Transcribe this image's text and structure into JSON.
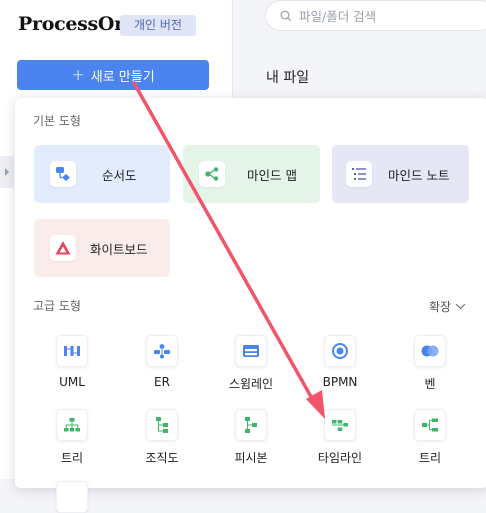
{
  "header": {
    "logo": "ProcessOn",
    "edition_badge": "개인 버전",
    "new_button_label": "새로 만들기",
    "search_placeholder": "파일/폴더 검색",
    "section_title": "내 파일"
  },
  "panel": {
    "basic_title": "기본 도형",
    "basic_cards": [
      {
        "label": "순서도",
        "icon": "flowchart-icon",
        "bg": "#e3ecfd"
      },
      {
        "label": "마인드 맵",
        "icon": "mindmap-icon",
        "bg": "#e4f4e9"
      },
      {
        "label": "마인드 노트",
        "icon": "mind-note-icon",
        "bg": "#e5e8f4"
      },
      {
        "label": "화이트보드",
        "icon": "whiteboard-icon",
        "bg": "#fbecec"
      }
    ],
    "advanced_title": "고급 도형",
    "expand_label": "확장",
    "advanced_tiles": [
      {
        "label": "UML",
        "icon": "uml-icon"
      },
      {
        "label": "ER",
        "icon": "er-icon"
      },
      {
        "label": "스윔레인",
        "icon": "swimlane-icon"
      },
      {
        "label": "BPMN",
        "icon": "bpmn-icon"
      },
      {
        "label": "벤",
        "icon": "venn-icon"
      },
      {
        "label": "트리",
        "icon": "tree-icon"
      },
      {
        "label": "조직도",
        "icon": "org-chart-icon"
      },
      {
        "label": "피시본",
        "icon": "fishbone-icon"
      },
      {
        "label": "타임라인",
        "icon": "timeline-icon"
      },
      {
        "label": "트리",
        "icon": "tree-right-icon"
      }
    ]
  },
  "colors": {
    "accent": "#4b84ee",
    "annotation_arrow": "#f2546a",
    "green_icon": "#3fb56a"
  }
}
